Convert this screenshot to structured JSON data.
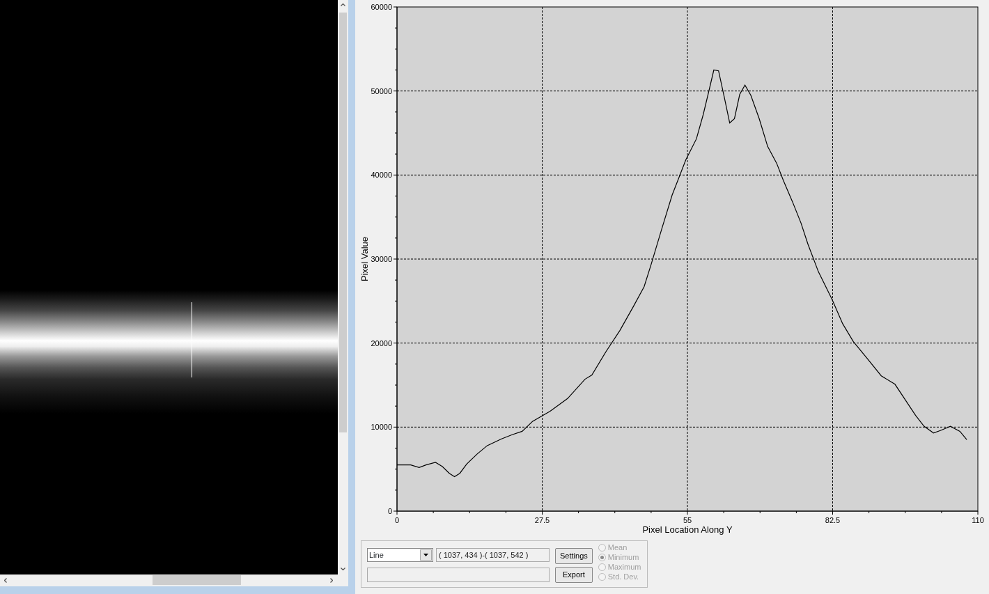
{
  "image_view": {
    "profile_line": true
  },
  "chart": {
    "chart_data": {
      "type": "line",
      "xlabel": "Pixel Location Along Y",
      "ylabel": "Pixel Value",
      "xlim": [
        0,
        110
      ],
      "ylim": [
        0,
        60000
      ],
      "xticks": [
        0,
        27.5,
        55,
        82.5,
        110
      ],
      "yticks": [
        0,
        10000,
        20000,
        30000,
        40000,
        50000,
        60000
      ],
      "x": [
        0,
        2.6,
        4.2,
        5.5,
        7.3,
        8.6,
        9.9,
        10.9,
        11.9,
        13.2,
        15.2,
        17.1,
        19.8,
        21.8,
        23.7,
        25.7,
        29.0,
        32.3,
        35.6,
        36.9,
        39.6,
        42.2,
        44.8,
        46.8,
        48.1,
        50.1,
        52.1,
        54.7,
        56.7,
        58.0,
        59.1,
        60.0,
        60.9,
        62.0,
        63.0,
        63.9,
        64.9,
        65.9,
        67.0,
        68.6,
        70.2,
        71.9,
        73.2,
        74.9,
        76.5,
        77.8,
        79.8,
        82.4,
        84.4,
        86.4,
        89.0,
        91.7,
        94.3,
        96.3,
        98.2,
        99.8,
        101.6,
        102.9,
        104.8,
        106.6,
        107.9
      ],
      "series": [
        {
          "color": "#000000",
          "values": [
            5500,
            5500,
            5200,
            5500,
            5800,
            5300,
            4500,
            4100,
            4500,
            5600,
            6800,
            7800,
            8600,
            9100,
            9500,
            10700,
            11900,
            13400,
            15700,
            16200,
            19000,
            21500,
            24400,
            26700,
            29300,
            33500,
            37600,
            41800,
            44300,
            47200,
            50100,
            52500,
            52400,
            49200,
            46200,
            46700,
            49600,
            50700,
            49500,
            46700,
            43400,
            41400,
            39300,
            36800,
            34300,
            31800,
            28500,
            25200,
            22300,
            20200,
            18200,
            16100,
            15100,
            13200,
            11400,
            10100,
            9300,
            9600,
            10100,
            9500,
            8500
          ]
        }
      ],
      "grid": true
    }
  },
  "controls": {
    "mode": "Line",
    "coordinates": "( 1037, 434 )-( 1037, 542 )",
    "buttons": [
      "Settings",
      "Export"
    ],
    "radios": [
      {
        "label": "Mean",
        "selected": false,
        "disabled": true
      },
      {
        "label": "Minimum",
        "selected": true,
        "disabled": true
      },
      {
        "label": "Maximum",
        "selected": false,
        "disabled": true
      },
      {
        "label": "Std. Dev.",
        "selected": false,
        "disabled": true
      }
    ]
  }
}
